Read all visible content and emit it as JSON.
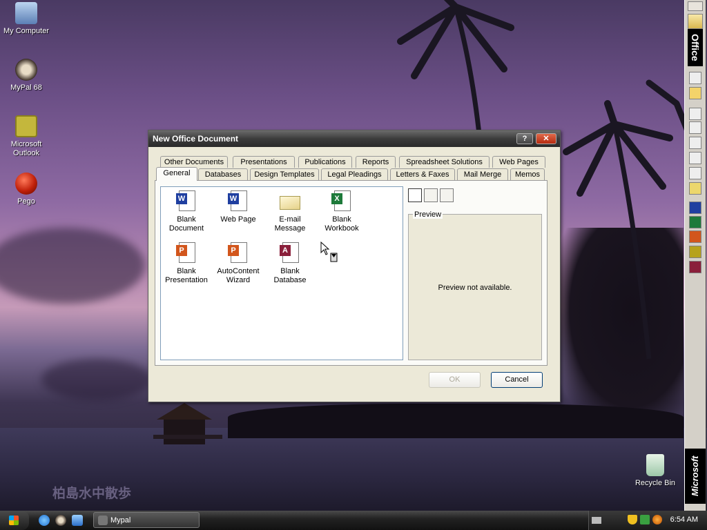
{
  "desktop": {
    "icons": [
      {
        "label": "My Computer",
        "icon": "my-computer-icon"
      },
      {
        "label": "MyPal 68",
        "icon": "mypal-raccoon-icon"
      },
      {
        "label": "Microsoft Outlook",
        "icon": "outlook-icon"
      },
      {
        "label": "Pego",
        "icon": "pego-red-ball-icon"
      },
      {
        "label": "Recycle Bin",
        "icon": "recycle-bin-icon"
      }
    ],
    "watermark": "柏島水中散歩"
  },
  "office_bar": {
    "title": "Office",
    "brand": "Microsoft"
  },
  "dialog": {
    "title": "New Office Document",
    "help_label": "?",
    "close_label": "✕",
    "tabs_back": [
      "Other Documents",
      "Presentations",
      "Publications",
      "Reports",
      "Spreadsheet Solutions",
      "Web Pages"
    ],
    "tabs_front": [
      "General",
      "Databases",
      "Design Templates",
      "Legal Pleadings",
      "Letters & Faxes",
      "Mail Merge",
      "Memos"
    ],
    "active_tab": "General",
    "items": [
      {
        "label": "Blank Document",
        "icon": "word-document-icon",
        "color": "#1f3fa0"
      },
      {
        "label": "Web Page",
        "icon": "word-web-page-icon",
        "color": "#1f3fa0"
      },
      {
        "label": "E-mail Message",
        "icon": "envelope-icon",
        "color": "#c9b46a"
      },
      {
        "label": "Blank Workbook",
        "icon": "excel-workbook-icon",
        "color": "#1d7a3a"
      },
      {
        "label": "Blank Presentation",
        "icon": "powerpoint-icon",
        "color": "#d2561c"
      },
      {
        "label": "AutoContent Wizard",
        "icon": "wizard-wand-icon",
        "color": "#d2561c"
      },
      {
        "label": "Blank Database",
        "icon": "access-database-icon",
        "color": "#8a1f3a"
      }
    ],
    "preview_label": "Preview",
    "preview_message": "Preview not available.",
    "ok_label": "OK",
    "cancel_label": "Cancel"
  },
  "taskbar": {
    "task_label": "Mypal",
    "clock": "6:54 AM"
  }
}
